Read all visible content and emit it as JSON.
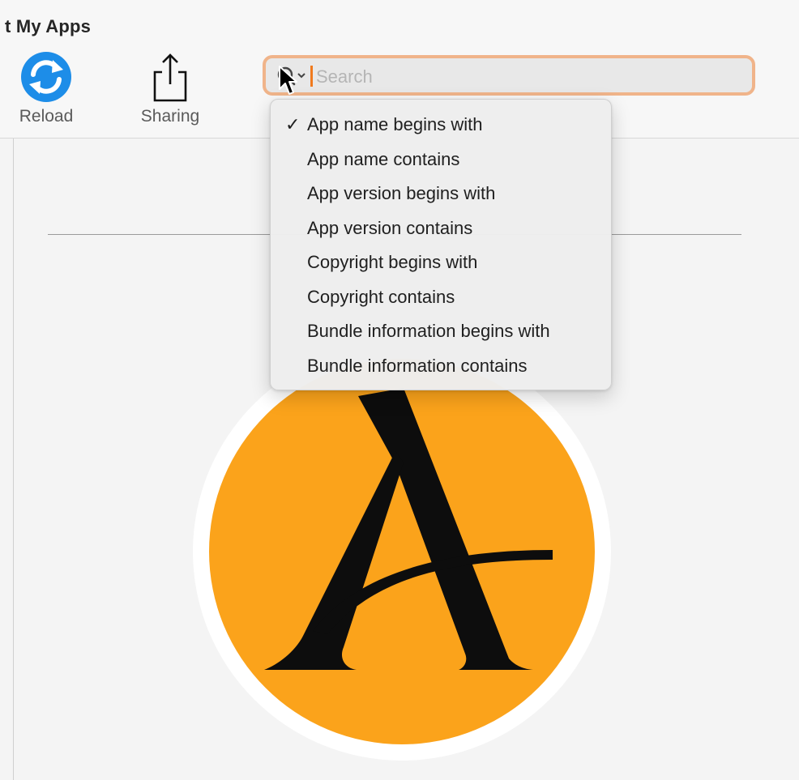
{
  "window": {
    "title": "t My Apps"
  },
  "toolbar": {
    "reload_label": "Reload",
    "reload_icon": "reload-icon",
    "sharing_label": "Sharing",
    "sharing_icon": "share-icon"
  },
  "search": {
    "placeholder": "Search",
    "value": "",
    "icon": "search-icon",
    "accent_color": "#f0b48a"
  },
  "search_menu": {
    "selected_index": 0,
    "items": [
      {
        "label": "App name begins with",
        "checked": "✓"
      },
      {
        "label": "App name contains",
        "checked": ""
      },
      {
        "label": "App version begins with",
        "checked": ""
      },
      {
        "label": "App version contains",
        "checked": ""
      },
      {
        "label": "Copyright begins with",
        "checked": ""
      },
      {
        "label": "Copyright contains",
        "checked": ""
      },
      {
        "label": "Bundle information begins with",
        "checked": ""
      },
      {
        "label": "Bundle information contains",
        "checked": ""
      }
    ]
  },
  "app_icon": {
    "icon": "letter-a-app-icon",
    "fill_color": "#fba31b"
  }
}
